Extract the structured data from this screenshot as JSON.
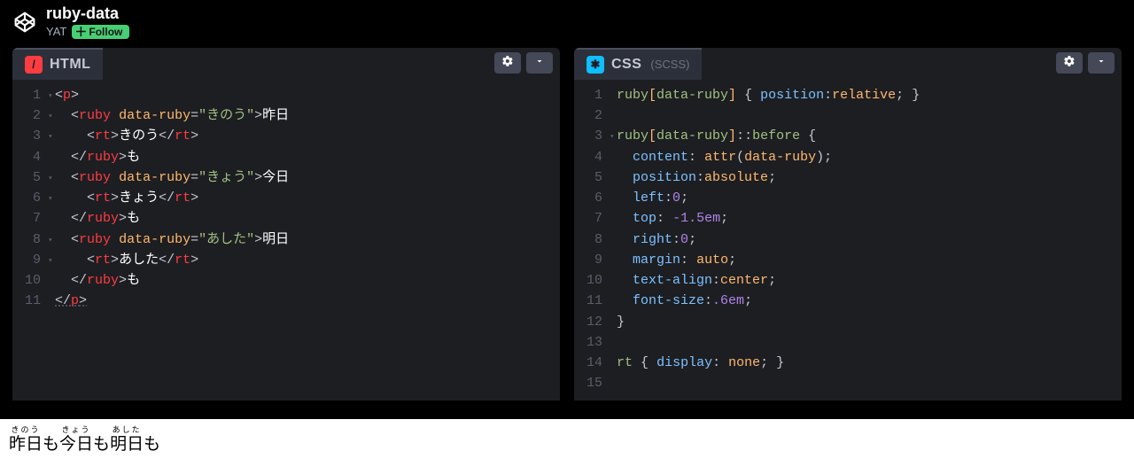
{
  "header": {
    "pen_title": "ruby-data",
    "author": "YAT",
    "follow_label": "Follow"
  },
  "panes": {
    "html": {
      "lang_label": "HTML",
      "lines": [
        {
          "n": "1",
          "fold": true,
          "html": "<span class='tok-punct'>&lt;</span><span class='tok-tag'>p</span><span class='tok-punct'>&gt;</span>"
        },
        {
          "n": "2",
          "fold": true,
          "html": "  <span class='tok-punct'>&lt;</span><span class='tok-tag'>ruby</span> <span class='tok-attr'>data-ruby</span><span class='tok-punct'>=</span><span class='tok-string'>\"きのう\"</span><span class='tok-punct'>&gt;</span><span class='tok-text'>昨日</span>"
        },
        {
          "n": "3",
          "fold": true,
          "html": "    <span class='tok-punct'>&lt;</span><span class='tok-tag'>rt</span><span class='tok-punct'>&gt;</span><span class='tok-text'>きのう</span><span class='tok-punct'>&lt;/</span><span class='tok-tag'>rt</span><span class='tok-punct'>&gt;</span>"
        },
        {
          "n": "4",
          "html": "  <span class='tok-punct'>&lt;/</span><span class='tok-tag'>ruby</span><span class='tok-punct'>&gt;</span><span class='tok-text'>も</span>"
        },
        {
          "n": "5",
          "fold": true,
          "html": "  <span class='tok-punct'>&lt;</span><span class='tok-tag'>ruby</span> <span class='tok-attr'>data-ruby</span><span class='tok-punct'>=</span><span class='tok-string'>\"きょう\"</span><span class='tok-punct'>&gt;</span><span class='tok-text'>今日</span>"
        },
        {
          "n": "6",
          "fold": true,
          "html": "    <span class='tok-punct'>&lt;</span><span class='tok-tag'>rt</span><span class='tok-punct'>&gt;</span><span class='tok-text'>きょう</span><span class='tok-punct'>&lt;/</span><span class='tok-tag'>rt</span><span class='tok-punct'>&gt;</span>"
        },
        {
          "n": "7",
          "html": "  <span class='tok-punct'>&lt;/</span><span class='tok-tag'>ruby</span><span class='tok-punct'>&gt;</span><span class='tok-text'>も</span>"
        },
        {
          "n": "8",
          "fold": true,
          "html": "  <span class='tok-punct'>&lt;</span><span class='tok-tag'>ruby</span> <span class='tok-attr'>data-ruby</span><span class='tok-punct'>=</span><span class='tok-string'>\"あした\"</span><span class='tok-punct'>&gt;</span><span class='tok-text'>明日</span>"
        },
        {
          "n": "9",
          "fold": true,
          "html": "    <span class='tok-punct'>&lt;</span><span class='tok-tag'>rt</span><span class='tok-punct'>&gt;</span><span class='tok-text'>あした</span><span class='tok-punct'>&lt;/</span><span class='tok-tag'>rt</span><span class='tok-punct'>&gt;</span>"
        },
        {
          "n": "10",
          "html": "  <span class='tok-punct'>&lt;/</span><span class='tok-tag'>ruby</span><span class='tok-punct'>&gt;</span><span class='tok-text'>も</span>"
        },
        {
          "n": "11",
          "html": "<span class='tok-punct' style='text-decoration:underline dotted #5a5d6a'>&lt;/</span><span class='tok-tag' style='text-decoration:underline dotted #5a5d6a'>p</span><span class='tok-punct' style='text-decoration:underline dotted #5a5d6a'>&gt;</span>"
        }
      ]
    },
    "css": {
      "lang_label": "CSS",
      "lang_sublabel": "(SCSS)",
      "lines": [
        {
          "n": "1",
          "html": "<span class='tok-sel'>ruby</span><span class='tok-sel-br'>[</span><span class='tok-sel'>data-ruby</span><span class='tok-sel-br'>]</span> <span class='tok-punct'>{</span> <span class='tok-prop'>position</span><span class='tok-punct'>:</span><span class='tok-val'>relative</span><span class='tok-punct'>;</span> <span class='tok-punct'>}</span>"
        },
        {
          "n": "2",
          "html": ""
        },
        {
          "n": "3",
          "fold": true,
          "html": "<span class='tok-sel'>ruby</span><span class='tok-sel-br'>[</span><span class='tok-sel'>data-ruby</span><span class='tok-sel-br'>]</span><span class='tok-punct'>::</span><span class='tok-pseudo'>before</span> <span class='tok-punct'>{</span>"
        },
        {
          "n": "4",
          "html": "  <span class='tok-prop'>content</span><span class='tok-punct'>:</span> <span class='tok-val'>attr</span><span class='tok-punct'>(</span><span class='tok-val'>data-ruby</span><span class='tok-punct'>);</span>"
        },
        {
          "n": "5",
          "html": "  <span class='tok-prop'>position</span><span class='tok-punct'>:</span><span class='tok-val'>absolute</span><span class='tok-punct'>;</span>"
        },
        {
          "n": "6",
          "html": "  <span class='tok-prop'>left</span><span class='tok-punct'>:</span><span class='tok-num'>0</span><span class='tok-punct'>;</span>"
        },
        {
          "n": "7",
          "html": "  <span class='tok-prop'>top</span><span class='tok-punct'>:</span> <span class='tok-num'>-1.5em</span><span class='tok-punct'>;</span>"
        },
        {
          "n": "8",
          "html": "  <span class='tok-prop'>right</span><span class='tok-punct'>:</span><span class='tok-num'>0</span><span class='tok-punct'>;</span>"
        },
        {
          "n": "9",
          "html": "  <span class='tok-prop'>margin</span><span class='tok-punct'>:</span> <span class='tok-val'>auto</span><span class='tok-punct'>;</span>"
        },
        {
          "n": "10",
          "html": "  <span class='tok-prop'>text-align</span><span class='tok-punct'>:</span><span class='tok-val'>center</span><span class='tok-punct'>;</span>"
        },
        {
          "n": "11",
          "html": "  <span class='tok-prop'>font-size</span><span class='tok-punct'>:</span><span class='tok-num'>.6em</span><span class='tok-punct'>;</span>"
        },
        {
          "n": "12",
          "html": "<span class='tok-punct'>}</span>"
        },
        {
          "n": "13",
          "html": ""
        },
        {
          "n": "14",
          "html": "<span class='tok-sel'>rt</span> <span class='tok-punct'>{</span> <span class='tok-prop'>display</span><span class='tok-punct'>:</span> <span class='tok-val'>none</span><span class='tok-punct'>;</span> <span class='tok-punct'>}</span>"
        },
        {
          "n": "15",
          "html": ""
        }
      ]
    }
  },
  "preview": {
    "units": [
      {
        "rt": "きのう",
        "rb": "昨日"
      },
      {
        "plain": "も "
      },
      {
        "rt": "きょう",
        "rb": "今日"
      },
      {
        "plain": "も "
      },
      {
        "rt": "あした",
        "rb": "明日"
      },
      {
        "plain": "も"
      }
    ]
  }
}
